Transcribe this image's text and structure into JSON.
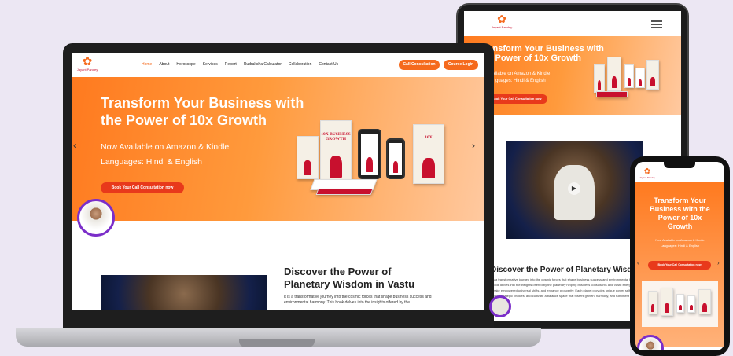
{
  "brand": {
    "name": "Jayant Pandey"
  },
  "nav": [
    "Home",
    "About",
    "Horoscope",
    "Services",
    "Report",
    "Rudraksha Calculator",
    "Collaboration",
    "Contact Us"
  ],
  "buttons": {
    "call": "Call Consultation",
    "login": "Course Login",
    "book_call": "Book Your Call Consultation now",
    "book_call_short": "Book Your Call Consultation now"
  },
  "hero": {
    "title_line1": "Transform Your Business with",
    "title_line2": "the Power of 10x Growth",
    "sub1": "Now Available on Amazon & Kindle",
    "sub2": "Languages: Hindi & English"
  },
  "book": {
    "title": "10X BUSINESS GROWTH"
  },
  "section": {
    "title_line1": "Discover the Power of",
    "title_line2": "Planetary Wisdom in Vastu",
    "body": "It is a transformative journey into the cosmic forces that shape business success and environmental harmony. This book delves into the insights offered by the"
  },
  "tablet": {
    "title_line1": "Transform Your Business with",
    "title_line2": "the Power of 10x Growth",
    "sub1": "available on Amazon & Kindle",
    "sub2": "Languages: Hindi & English",
    "btn": "Book Your Call Consultation now",
    "section_title": "Discover the Power of Planetary Wisdom",
    "body": "is a transformative journey into the cosmic forces that shape business success and environmental harmony. This book delves into the insights offered by the planetary helping business consultants and Vastu energy experts make empowered universal shifts, and enhance prosperity. Each planet provides unique power self-awareness, guide strategic choices, and cultivate a balance space that fosters growth, harmony, and fulfillment in both business"
  },
  "phone": {
    "title_line1": "Transform Your",
    "title_line2": "Business with the",
    "title_line3": "Power of 10x",
    "title_line4": "Growth",
    "sub1": "Now Available on Amazon & Kindle",
    "sub2": "Languages: Hindi & English",
    "btn": "Book Your Call Consultation now"
  },
  "colors": {
    "accent": "#f56a1d",
    "bg": "#ece7f3"
  }
}
